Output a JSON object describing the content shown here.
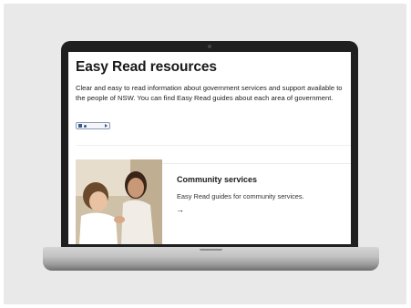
{
  "page": {
    "title": "Easy Read resources",
    "intro": "Clear and easy to read information about government services and support available to the people of NSW. You can find Easy Read guides about each area of government."
  },
  "card": {
    "title": "Community services",
    "description": "Easy Read guides for community services.",
    "arrow": "→",
    "image_description": "woman and child"
  },
  "colors": {
    "background": "#e9e9e9",
    "laptop_frame": "#1f1f1f",
    "text": "#1a1a1a"
  }
}
